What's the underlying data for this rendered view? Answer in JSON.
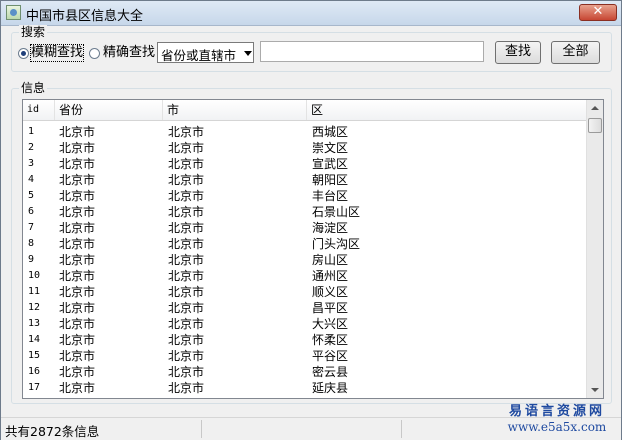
{
  "window": {
    "title": "中国市县区信息大全",
    "close_symbol": "✕"
  },
  "search": {
    "group_label": "搜索",
    "mode_fuzzy_label": "模糊查找",
    "mode_exact_label": "精确查找",
    "selected_mode": "模糊查找",
    "province_select_value": "省份或直辖市",
    "query_value": "",
    "find_button": "查找",
    "all_button": "全部"
  },
  "info": {
    "group_label": "信息",
    "columns": [
      "id",
      "省份",
      "市",
      "区"
    ],
    "rows": [
      [
        "1",
        "北京市",
        "北京市",
        "西城区"
      ],
      [
        "2",
        "北京市",
        "北京市",
        "崇文区"
      ],
      [
        "3",
        "北京市",
        "北京市",
        "宣武区"
      ],
      [
        "4",
        "北京市",
        "北京市",
        "朝阳区"
      ],
      [
        "5",
        "北京市",
        "北京市",
        "丰台区"
      ],
      [
        "6",
        "北京市",
        "北京市",
        "石景山区"
      ],
      [
        "7",
        "北京市",
        "北京市",
        "海淀区"
      ],
      [
        "8",
        "北京市",
        "北京市",
        "门头沟区"
      ],
      [
        "9",
        "北京市",
        "北京市",
        "房山区"
      ],
      [
        "10",
        "北京市",
        "北京市",
        "通州区"
      ],
      [
        "11",
        "北京市",
        "北京市",
        "顺义区"
      ],
      [
        "12",
        "北京市",
        "北京市",
        "昌平区"
      ],
      [
        "13",
        "北京市",
        "北京市",
        "大兴区"
      ],
      [
        "14",
        "北京市",
        "北京市",
        "怀柔区"
      ],
      [
        "15",
        "北京市",
        "北京市",
        "平谷区"
      ],
      [
        "16",
        "北京市",
        "北京市",
        "密云县"
      ],
      [
        "17",
        "北京市",
        "北京市",
        "延庆县"
      ]
    ]
  },
  "statusbar": {
    "text": "共有2872条信息"
  },
  "watermark": {
    "line1": "易语言资源网",
    "line2": "www.e5a5x.com"
  }
}
